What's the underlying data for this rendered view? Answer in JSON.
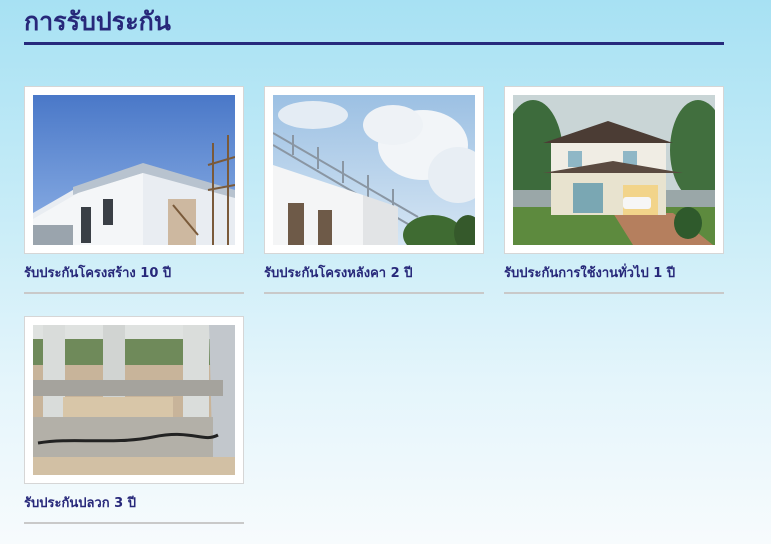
{
  "page": {
    "title": "การรับประกัน"
  },
  "cards": [
    {
      "caption": "รับประกันโครงสร้าง 10 ปี",
      "image": "house-structure-under-construction"
    },
    {
      "caption": "รับประกันโครงหลังคา 2 ปี",
      "image": "steel-roof-frame-against-sky"
    },
    {
      "caption": "รับประกันการใช้งานทั่วไป 1 ปี",
      "image": "completed-two-storey-house"
    },
    {
      "caption": "รับประกันปลวก 3 ปี",
      "image": "foundation-anti-termite-work"
    }
  ],
  "colors": {
    "title": "#27287a",
    "title_rule": "#262a7c",
    "caption_rule": "#c9c9c9"
  }
}
